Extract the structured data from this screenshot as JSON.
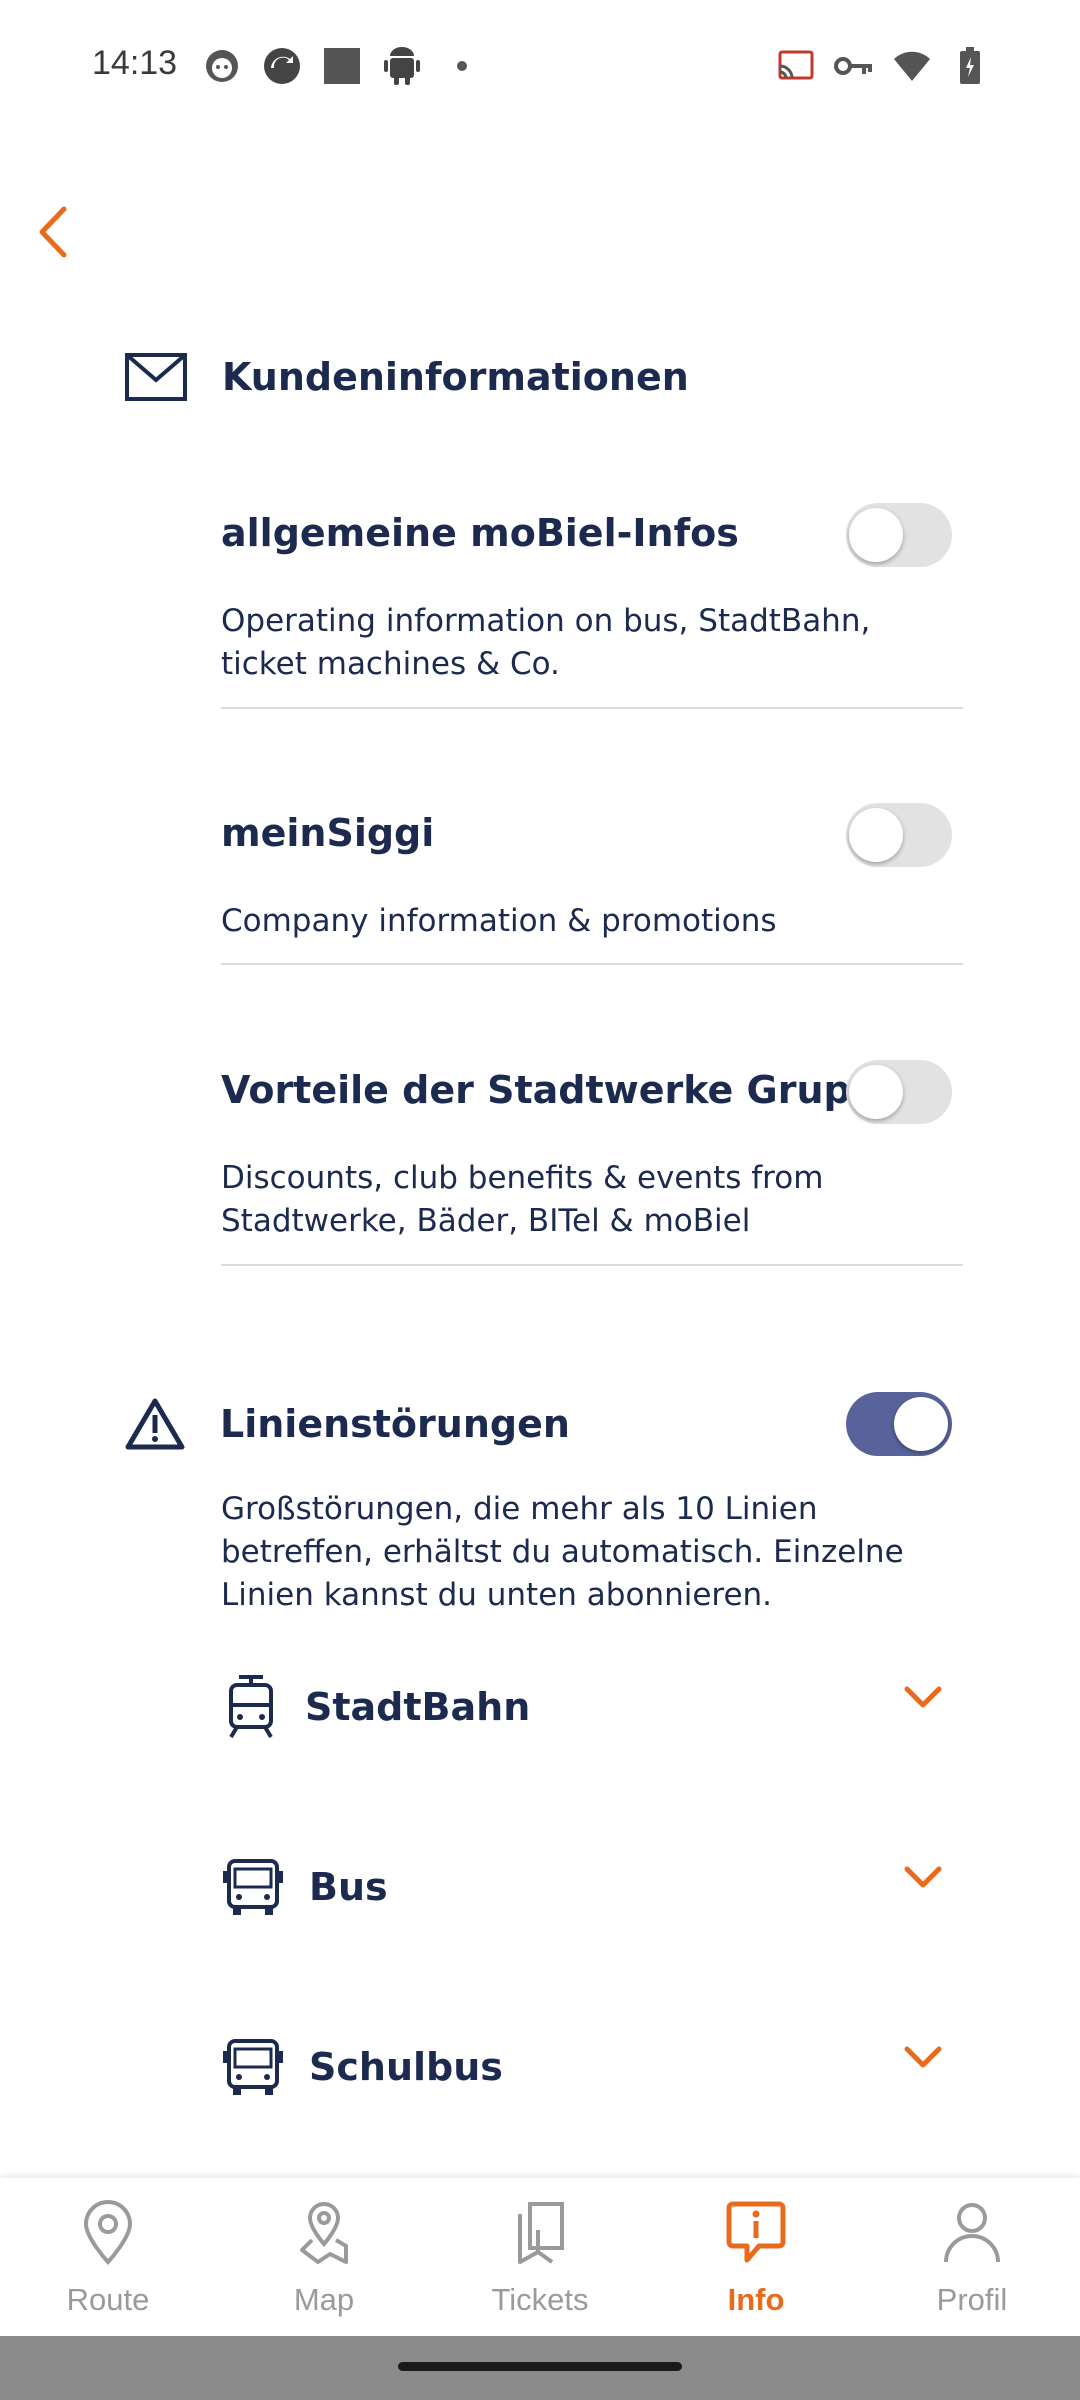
{
  "status_bar": {
    "time": "14:13",
    "left_icons": [
      "face-icon",
      "sync-icon",
      "square-icon",
      "android-icon",
      "dot-icon"
    ],
    "right_icons": [
      "cast-icon",
      "key-icon",
      "wifi-icon",
      "battery-icon"
    ]
  },
  "colors": {
    "accent": "#EA6A1C",
    "navy": "#1B2A4E",
    "toggle_on": "#57639A"
  },
  "customer_info": {
    "title": "Kundeninformationen",
    "icon": "mail-icon",
    "options": [
      {
        "title": "allgemeine moBiel-Infos",
        "description": "Operating information on bus, StadtBahn, ticket machines & Co.",
        "enabled": false
      },
      {
        "title": "meinSiggi",
        "description": "Company information & promotions",
        "enabled": false
      },
      {
        "title": "Vorteile der Stadtwerke Gruppe",
        "description": "Discounts, club benefits & events from Stadtwerke, Bäder, BITel & moBiel",
        "enabled": false
      }
    ]
  },
  "disruptions": {
    "title": "Linienstörungen",
    "icon": "warning-icon",
    "enabled": true,
    "description": "Großstörungen, die mehr als 10 Linien betreffen, erhältst du automatisch. Einzelne Linien kannst du unten abonnieren.",
    "lines": [
      {
        "label": "StadtBahn",
        "icon": "tram-icon"
      },
      {
        "label": "Bus",
        "icon": "bus-icon"
      },
      {
        "label": "Schulbus",
        "icon": "school-bus-icon"
      }
    ]
  },
  "tabs": [
    {
      "label": "Route",
      "icon": "pin-icon",
      "active": false
    },
    {
      "label": "Map",
      "icon": "map-pin-icon",
      "active": false
    },
    {
      "label": "Tickets",
      "icon": "ticket-icon",
      "active": false
    },
    {
      "label": "Info",
      "icon": "info-bubble-icon",
      "active": true
    },
    {
      "label": "Profil",
      "icon": "person-icon",
      "active": false
    }
  ]
}
